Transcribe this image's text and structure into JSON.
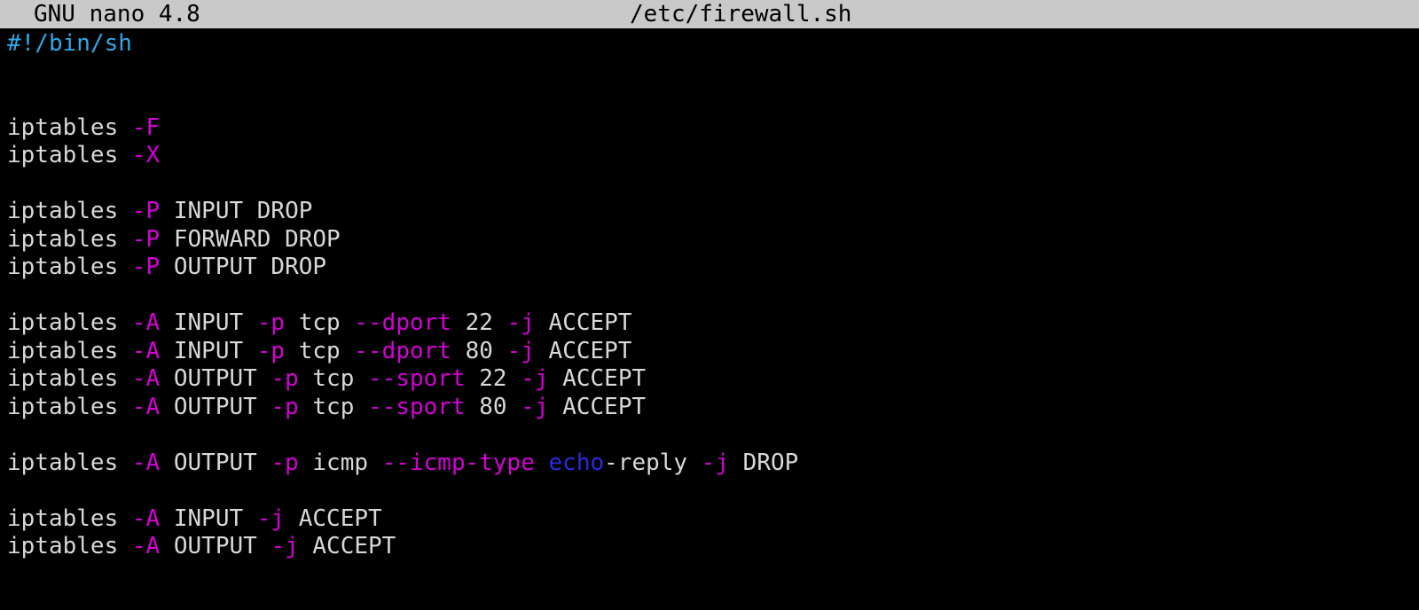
{
  "titlebar": {
    "app_name": "GNU nano 4.8",
    "file_name": "/etc/firewall.sh"
  },
  "colors": {
    "titlebar_bg": "#c9c9c9",
    "background": "#000000",
    "plain_text": "#d8d8d8",
    "option_flag": "#d400d4",
    "shebang": "#2fa8e8",
    "keyword": "#2a2ae0"
  },
  "editor": {
    "lines": [
      [
        {
          "t": "#!/bin/sh",
          "c": "shebang"
        }
      ],
      [],
      [],
      [
        {
          "t": "iptables ",
          "c": "plain"
        },
        {
          "t": "-F",
          "c": "flag"
        }
      ],
      [
        {
          "t": "iptables ",
          "c": "plain"
        },
        {
          "t": "-X",
          "c": "flag"
        }
      ],
      [],
      [
        {
          "t": "iptables ",
          "c": "plain"
        },
        {
          "t": "-P",
          "c": "flag"
        },
        {
          "t": " INPUT DROP",
          "c": "plain"
        }
      ],
      [
        {
          "t": "iptables ",
          "c": "plain"
        },
        {
          "t": "-P",
          "c": "flag"
        },
        {
          "t": " FORWARD DROP",
          "c": "plain"
        }
      ],
      [
        {
          "t": "iptables ",
          "c": "plain"
        },
        {
          "t": "-P",
          "c": "flag"
        },
        {
          "t": " OUTPUT DROP",
          "c": "plain"
        }
      ],
      [],
      [
        {
          "t": "iptables ",
          "c": "plain"
        },
        {
          "t": "-A",
          "c": "flag"
        },
        {
          "t": " INPUT ",
          "c": "plain"
        },
        {
          "t": "-p",
          "c": "flag"
        },
        {
          "t": " tcp ",
          "c": "plain"
        },
        {
          "t": "--dport",
          "c": "flag"
        },
        {
          "t": " 22 ",
          "c": "plain"
        },
        {
          "t": "-j",
          "c": "flag"
        },
        {
          "t": " ACCEPT",
          "c": "plain"
        }
      ],
      [
        {
          "t": "iptables ",
          "c": "plain"
        },
        {
          "t": "-A",
          "c": "flag"
        },
        {
          "t": " INPUT ",
          "c": "plain"
        },
        {
          "t": "-p",
          "c": "flag"
        },
        {
          "t": " tcp ",
          "c": "plain"
        },
        {
          "t": "--dport",
          "c": "flag"
        },
        {
          "t": " 80 ",
          "c": "plain"
        },
        {
          "t": "-j",
          "c": "flag"
        },
        {
          "t": " ACCEPT",
          "c": "plain"
        }
      ],
      [
        {
          "t": "iptables ",
          "c": "plain"
        },
        {
          "t": "-A",
          "c": "flag"
        },
        {
          "t": " OUTPUT ",
          "c": "plain"
        },
        {
          "t": "-p",
          "c": "flag"
        },
        {
          "t": " tcp ",
          "c": "plain"
        },
        {
          "t": "--sport",
          "c": "flag"
        },
        {
          "t": " 22 ",
          "c": "plain"
        },
        {
          "t": "-j",
          "c": "flag"
        },
        {
          "t": " ACCEPT",
          "c": "plain"
        }
      ],
      [
        {
          "t": "iptables ",
          "c": "plain"
        },
        {
          "t": "-A",
          "c": "flag"
        },
        {
          "t": " OUTPUT ",
          "c": "plain"
        },
        {
          "t": "-p",
          "c": "flag"
        },
        {
          "t": " tcp ",
          "c": "plain"
        },
        {
          "t": "--sport",
          "c": "flag"
        },
        {
          "t": " 80 ",
          "c": "plain"
        },
        {
          "t": "-j",
          "c": "flag"
        },
        {
          "t": " ACCEPT",
          "c": "plain"
        }
      ],
      [],
      [
        {
          "t": "iptables ",
          "c": "plain"
        },
        {
          "t": "-A",
          "c": "flag"
        },
        {
          "t": " OUTPUT ",
          "c": "plain"
        },
        {
          "t": "-p",
          "c": "flag"
        },
        {
          "t": " icmp ",
          "c": "plain"
        },
        {
          "t": "--icmp-type",
          "c": "flag"
        },
        {
          "t": " ",
          "c": "plain"
        },
        {
          "t": "echo",
          "c": "keyword"
        },
        {
          "t": "-reply ",
          "c": "plain"
        },
        {
          "t": "-j",
          "c": "flag"
        },
        {
          "t": " DROP",
          "c": "plain"
        }
      ],
      [],
      [
        {
          "t": "iptables ",
          "c": "plain"
        },
        {
          "t": "-A",
          "c": "flag"
        },
        {
          "t": " INPUT ",
          "c": "plain"
        },
        {
          "t": "-j",
          "c": "flag"
        },
        {
          "t": " ACCEPT",
          "c": "plain"
        }
      ],
      [
        {
          "t": "iptables ",
          "c": "plain"
        },
        {
          "t": "-A",
          "c": "flag"
        },
        {
          "t": " OUTPUT ",
          "c": "plain"
        },
        {
          "t": "-j",
          "c": "flag"
        },
        {
          "t": " ACCEPT",
          "c": "plain"
        }
      ]
    ]
  }
}
